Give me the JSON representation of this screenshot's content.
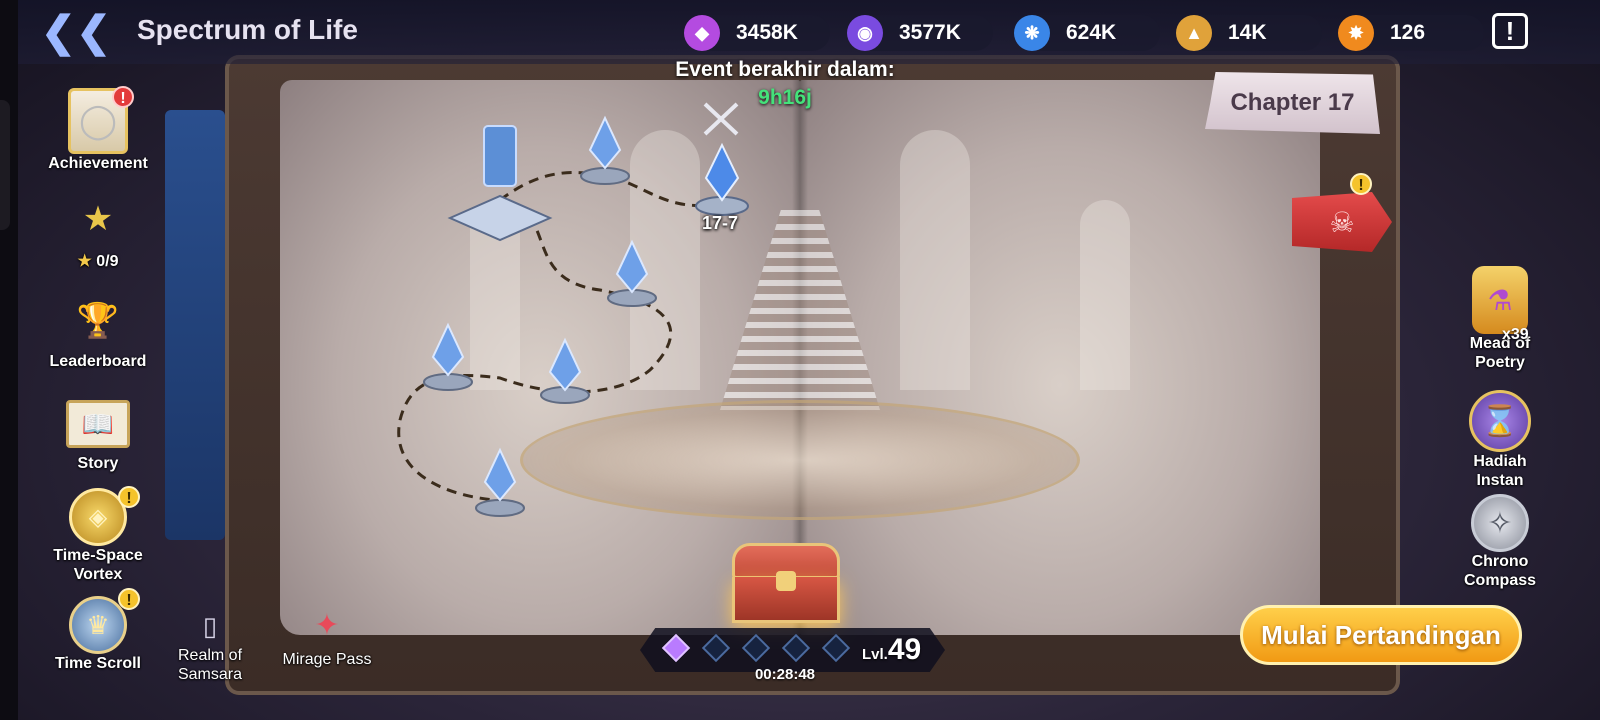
{
  "header": {
    "title": "Spectrum of Life",
    "currencies": [
      {
        "icon": "purple-gem-icon",
        "value": "3458K",
        "color": "#b44be0"
      },
      {
        "icon": "violet-eye-gem-icon",
        "value": "3577K",
        "color": "#7a4be0"
      },
      {
        "icon": "blue-crystal-icon",
        "value": "624K",
        "color": "#3a86e8"
      },
      {
        "icon": "gold-triangle-icon",
        "value": "14K",
        "color": "#e0a23a"
      },
      {
        "icon": "flame-swirl-icon",
        "value": "126",
        "color": "#f08a1e"
      }
    ],
    "info_glyph": "!"
  },
  "event": {
    "label": "Event berakhir dalam:",
    "time_left": "9h16j"
  },
  "chapter": "Chapter 17",
  "stage": {
    "current_label": "17-7"
  },
  "left_menu": [
    {
      "label": "Achievement",
      "icon": "achievement-card-icon",
      "alert": "red"
    },
    {
      "label": "0/9",
      "icon": "star-trophy-icon",
      "alert": ""
    },
    {
      "label": "Leaderboard",
      "icon": "trophy-icon",
      "alert": ""
    },
    {
      "label": "Story",
      "icon": "open-book-icon",
      "alert": ""
    },
    {
      "label": "Time-Space Vortex",
      "icon": "vortex-icon",
      "alert": "yellow"
    },
    {
      "label": "Time Scroll",
      "icon": "time-scroll-icon",
      "alert": "yellow"
    }
  ],
  "bottom_left": [
    {
      "label": "Realm of Samsara",
      "icon": "samsara-icon"
    },
    {
      "label": "Mirage Pass",
      "icon": "mirage-pass-icon"
    }
  ],
  "right_menu": [
    {
      "label": "Mead of Poetry",
      "icon": "potion-icon",
      "count": "x39"
    },
    {
      "label": "Hadiah Instan",
      "icon": "hourglass-icon"
    },
    {
      "label": "Chrono Compass",
      "icon": "compass-icon"
    }
  ],
  "progress": {
    "level_prefix": "Lvl.",
    "level": "49",
    "timer": "00:28:48",
    "filled_diamonds": 1,
    "total_diamonds": 5
  },
  "start_button": "Mulai Pertandingan",
  "colors": {
    "accent_gold": "#f19a14",
    "timer_green": "#44e27a",
    "boss_red": "#c83232"
  }
}
